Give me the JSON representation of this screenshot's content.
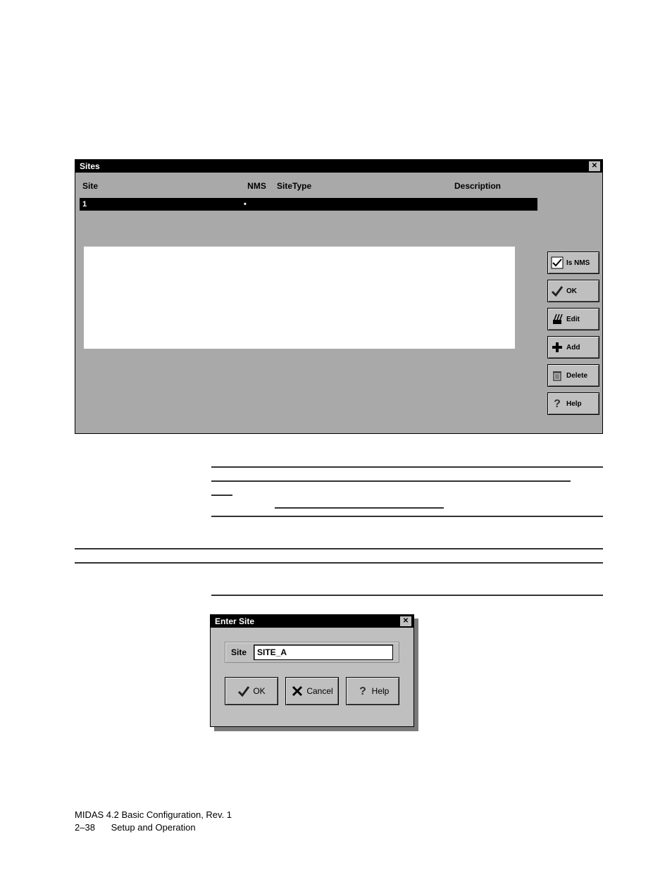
{
  "sites_window": {
    "title": "Sites",
    "columns": {
      "site": "Site",
      "nms": "NMS",
      "sitetype": "SiteType",
      "description": "Description"
    },
    "row": {
      "site": "1",
      "nms": "•",
      "sitetype": "",
      "description": ""
    },
    "buttons": {
      "isnms": "Is NMS",
      "ok": "OK",
      "edit": "Edit",
      "add": "Add",
      "delete": "Delete",
      "help": "Help"
    }
  },
  "enter_window": {
    "title": "Enter Site",
    "label": "Site",
    "value": "SITE_A",
    "buttons": {
      "ok": "OK",
      "cancel": "Cancel",
      "help": "Help"
    }
  },
  "footer": {
    "line1": "MIDAS 4.2 Basic Configuration,  Rev. 1",
    "page": "2–38",
    "section": "Setup and Operation"
  }
}
